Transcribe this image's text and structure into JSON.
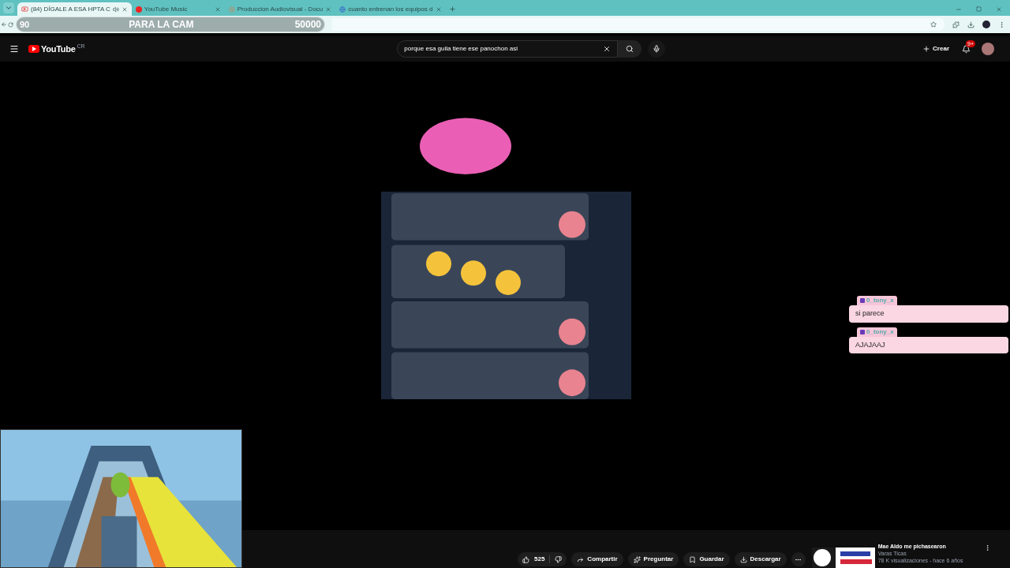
{
  "browser": {
    "tabs": [
      {
        "title": "(84) DÍGALE A ESA HPTA C",
        "selected": true,
        "audio": true
      },
      {
        "title": "YouTube Music",
        "selected": false,
        "audio": false
      },
      {
        "title": "Produccion Audiovisual - Docu",
        "selected": false,
        "audio": false
      },
      {
        "title": "cuanto entrenan los equipos d",
        "selected": false,
        "audio": false
      }
    ]
  },
  "goal_overlay": {
    "current": "90",
    "label": "PARA LA CAM",
    "target": "50000"
  },
  "youtube": {
    "logo": "YouTube",
    "region": "CR",
    "search": {
      "value": "porque esa guila tiene ese panochon asi"
    },
    "create": "Crear",
    "notifications": "9+"
  },
  "actions": {
    "likes": "525",
    "buttons": [
      "Compartir",
      "Preguntar",
      "Guardar",
      "Descargar"
    ]
  },
  "recommended": {
    "title": "Mae Aldo me pichasearon",
    "channel": "Varas Ticas",
    "meta": "78 K visualizaciones - hace 6 años"
  },
  "chat": [
    {
      "user": "0_tony_x",
      "text": "si parece"
    },
    {
      "user": "0_tony_x",
      "text": "AJAJAAJ"
    }
  ]
}
